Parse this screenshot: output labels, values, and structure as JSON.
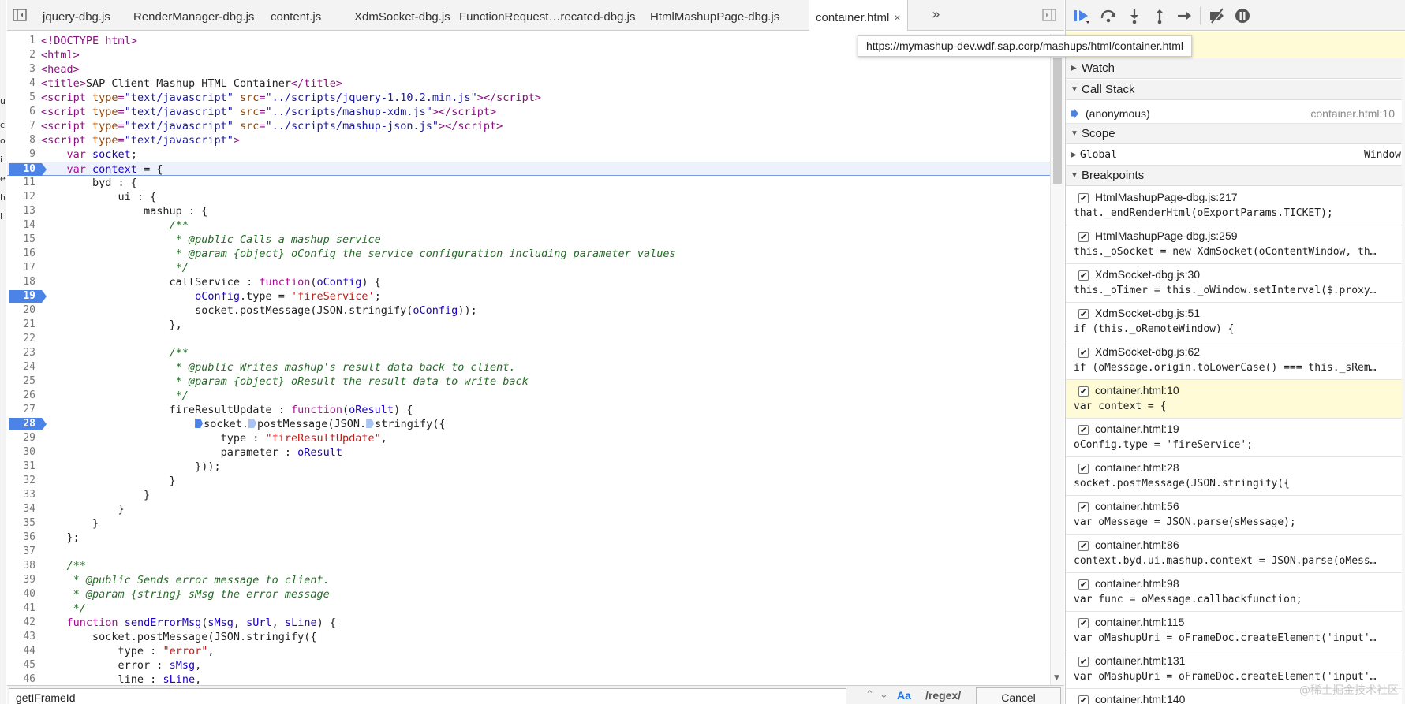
{
  "left_strip": {
    "chars": [
      "ui",
      "c",
      "o",
      "i",
      "e",
      "h",
      "i"
    ]
  },
  "tabs": [
    {
      "label": "jquery-dbg.js"
    },
    {
      "label": "RenderManager-dbg.js"
    },
    {
      "label": "content.js"
    },
    {
      "label": "XdmSocket-dbg.js"
    },
    {
      "label": "FunctionRequest…recated-dbg.js"
    },
    {
      "label": "HtmlMashupPage-dbg.js"
    },
    {
      "label": "container.html",
      "active": true
    }
  ],
  "tab_close": "×",
  "tab_more": "»",
  "tooltip": "https://mymashup-dev.wdf.sap.corp/mashups/html/container.html",
  "code": [
    {
      "n": "1",
      "html": "<span class='t-tag'>&lt;!DOCTYPE html&gt;</span>"
    },
    {
      "n": "2",
      "html": "<span class='t-tag'>&lt;html&gt;</span>"
    },
    {
      "n": "3",
      "html": "<span class='t-tag'>&lt;head&gt;</span>"
    },
    {
      "n": "4",
      "html": "<span class='t-tag'>&lt;title&gt;</span>SAP Client Mashup HTML Container<span class='t-tag'>&lt;/title&gt;</span>"
    },
    {
      "n": "5",
      "html": "<span class='t-tag'>&lt;script </span><span class='t-attr'>type</span><span class='t-tag'>=</span><span class='t-str'>\"text/javascript\"</span> <span class='t-attr'>src</span><span class='t-tag'>=</span><span class='t-str'>\"../scripts/jquery-1.10.2.min.js\"</span><span class='t-tag'>&gt;&lt;/script&gt;</span>"
    },
    {
      "n": "6",
      "html": "<span class='t-tag'>&lt;script </span><span class='t-attr'>type</span><span class='t-tag'>=</span><span class='t-str'>\"text/javascript\"</span> <span class='t-attr'>src</span><span class='t-tag'>=</span><span class='t-str'>\"../scripts/mashup-xdm.js\"</span><span class='t-tag'>&gt;&lt;/script&gt;</span>"
    },
    {
      "n": "7",
      "html": "<span class='t-tag'>&lt;script </span><span class='t-attr'>type</span><span class='t-tag'>=</span><span class='t-str'>\"text/javascript\"</span> <span class='t-attr'>src</span><span class='t-tag'>=</span><span class='t-str'>\"../scripts/mashup-json.js\"</span><span class='t-tag'>&gt;&lt;/script&gt;</span>"
    },
    {
      "n": "8",
      "html": "<span class='t-tag'>&lt;script </span><span class='t-attr'>type</span><span class='t-tag'>=</span><span class='t-str'>\"text/javascript\"</span><span class='t-tag'>&gt;</span>"
    },
    {
      "n": "9",
      "html": "    <span class='t-kw'>var</span> <span class='t-var'>socket</span>;"
    },
    {
      "n": "10",
      "bp": true,
      "current": true,
      "html": "    <span class='t-kw'>var</span> <span class='t-var'>context</span> = {"
    },
    {
      "n": "11",
      "html": "        byd : {"
    },
    {
      "n": "12",
      "html": "            ui : {"
    },
    {
      "n": "13",
      "html": "                mashup : {"
    },
    {
      "n": "14",
      "html": "                    <span class='t-cmt'>/**</span>"
    },
    {
      "n": "15",
      "html": "<span class='t-cmt'>                     * @public Calls a mashup service</span>"
    },
    {
      "n": "16",
      "html": "<span class='t-cmt'>                     * @param {object} oConfig the service configuration including parameter values</span>"
    },
    {
      "n": "17",
      "html": "<span class='t-cmt'>                     */</span>"
    },
    {
      "n": "18",
      "html": "                    callService : <span class='t-kw'>function</span>(<span class='t-var'>oConfig</span>) {"
    },
    {
      "n": "19",
      "bp": true,
      "html": "                        <span class='t-var'>oConfig</span>.type = <span class='t-q'>'fireService'</span>;"
    },
    {
      "n": "20",
      "html": "                        socket.postMessage(JSON.stringify(<span class='t-var'>oConfig</span>));"
    },
    {
      "n": "21",
      "html": "                    },"
    },
    {
      "n": "22",
      "html": ""
    },
    {
      "n": "23",
      "html": "                    <span class='t-cmt'>/**</span>"
    },
    {
      "n": "24",
      "html": "<span class='t-cmt'>                     * @public Writes mashup's result data back to client.</span>"
    },
    {
      "n": "25",
      "html": "<span class='t-cmt'>                     * @param {object} oResult the result data to write back</span>"
    },
    {
      "n": "26",
      "html": "<span class='t-cmt'>                     */</span>"
    },
    {
      "n": "27",
      "html": "                    fireResultUpdate : <span class='t-kw'>function</span>(<span class='t-var'>oResult</span>) {"
    },
    {
      "n": "28",
      "bp": true,
      "html": "                        <span class='mini-bp'></span>socket.<span class='mini-bp light'></span>postMessage(JSON.<span class='mini-bp light'></span>stringify({"
    },
    {
      "n": "29",
      "html": "                            type : <span class='t-q'>\"fireResultUpdate\"</span>,"
    },
    {
      "n": "30",
      "html": "                            parameter : <span class='t-var'>oResult</span>"
    },
    {
      "n": "31",
      "html": "                        }));"
    },
    {
      "n": "32",
      "html": "                    }"
    },
    {
      "n": "33",
      "html": "                }"
    },
    {
      "n": "34",
      "html": "            }"
    },
    {
      "n": "35",
      "html": "        }"
    },
    {
      "n": "36",
      "html": "    };"
    },
    {
      "n": "37",
      "html": ""
    },
    {
      "n": "38",
      "html": "    <span class='t-cmt'>/**</span>"
    },
    {
      "n": "39",
      "html": "<span class='t-cmt'>     * @public Sends error message to client.</span>"
    },
    {
      "n": "40",
      "html": "<span class='t-cmt'>     * @param {string} sMsg the error message</span>"
    },
    {
      "n": "41",
      "html": "<span class='t-cmt'>     */</span>"
    },
    {
      "n": "42",
      "html": "    <span class='t-kw'>function</span> <span class='t-var'>sendErrorMsg</span>(<span class='t-var'>sMsg</span>, <span class='t-var'>sUrl</span>, <span class='t-var'>sLine</span>) {"
    },
    {
      "n": "43",
      "html": "        socket.postMessage(JSON.stringify({"
    },
    {
      "n": "44",
      "html": "            type : <span class='t-q'>\"error\"</span>,"
    },
    {
      "n": "45",
      "html": "            error : <span class='t-var'>sMsg</span>,"
    },
    {
      "n": "46",
      "html": "            line : <span class='t-var'>sLine</span>,"
    }
  ],
  "search": {
    "value": "getIFrameId",
    "prev": "⌃",
    "next": "⌄",
    "case_label": "Aa",
    "regex_label": "/regex/",
    "cancel_label": "Cancel"
  },
  "sections": {
    "watch": "Watch",
    "call_stack": "Call Stack",
    "scope": "Scope",
    "breakpoints": "Breakpoints"
  },
  "call_stack": [
    {
      "fn": "(anonymous)",
      "loc": "container.html:10"
    }
  ],
  "scope": [
    {
      "name": "Global",
      "value": "Window"
    }
  ],
  "breakpoints": [
    {
      "loc": "HtmlMashupPage-dbg.js:217",
      "code": "that._endRenderHtml(oExportParams.TICKET);"
    },
    {
      "loc": "HtmlMashupPage-dbg.js:259",
      "code": "this._oSocket = new XdmSocket(oContentWindow, th…"
    },
    {
      "loc": "XdmSocket-dbg.js:30",
      "code": "this._oTimer = this._oWindow.setInterval($.proxy…"
    },
    {
      "loc": "XdmSocket-dbg.js:51",
      "code": "if (this._oRemoteWindow) {"
    },
    {
      "loc": "XdmSocket-dbg.js:62",
      "code": "if (oMessage.origin.toLowerCase() === this._sRem…"
    },
    {
      "loc": "container.html:10",
      "code": "var context = {",
      "highlight": true
    },
    {
      "loc": "container.html:19",
      "code": "oConfig.type = 'fireService';"
    },
    {
      "loc": "container.html:28",
      "code": "socket.postMessage(JSON.stringify({"
    },
    {
      "loc": "container.html:56",
      "code": "var oMessage = JSON.parse(sMessage);"
    },
    {
      "loc": "container.html:86",
      "code": "context.byd.ui.mashup.context = JSON.parse(oMess…"
    },
    {
      "loc": "container.html:98",
      "code": "var func = oMessage.callbackfunction;"
    },
    {
      "loc": "container.html:115",
      "code": "var oMashupUri = oFrameDoc.createElement('input'…"
    },
    {
      "loc": "container.html:131",
      "code": "var oMashupUri = oFrameDoc.createElement('input'…"
    },
    {
      "loc": "container.html:140",
      "code": ""
    }
  ],
  "watermark": "@稀土掘金技术社区",
  "colors": {
    "accent": "#4b84e6",
    "paused_bg": "#fffbd7"
  }
}
